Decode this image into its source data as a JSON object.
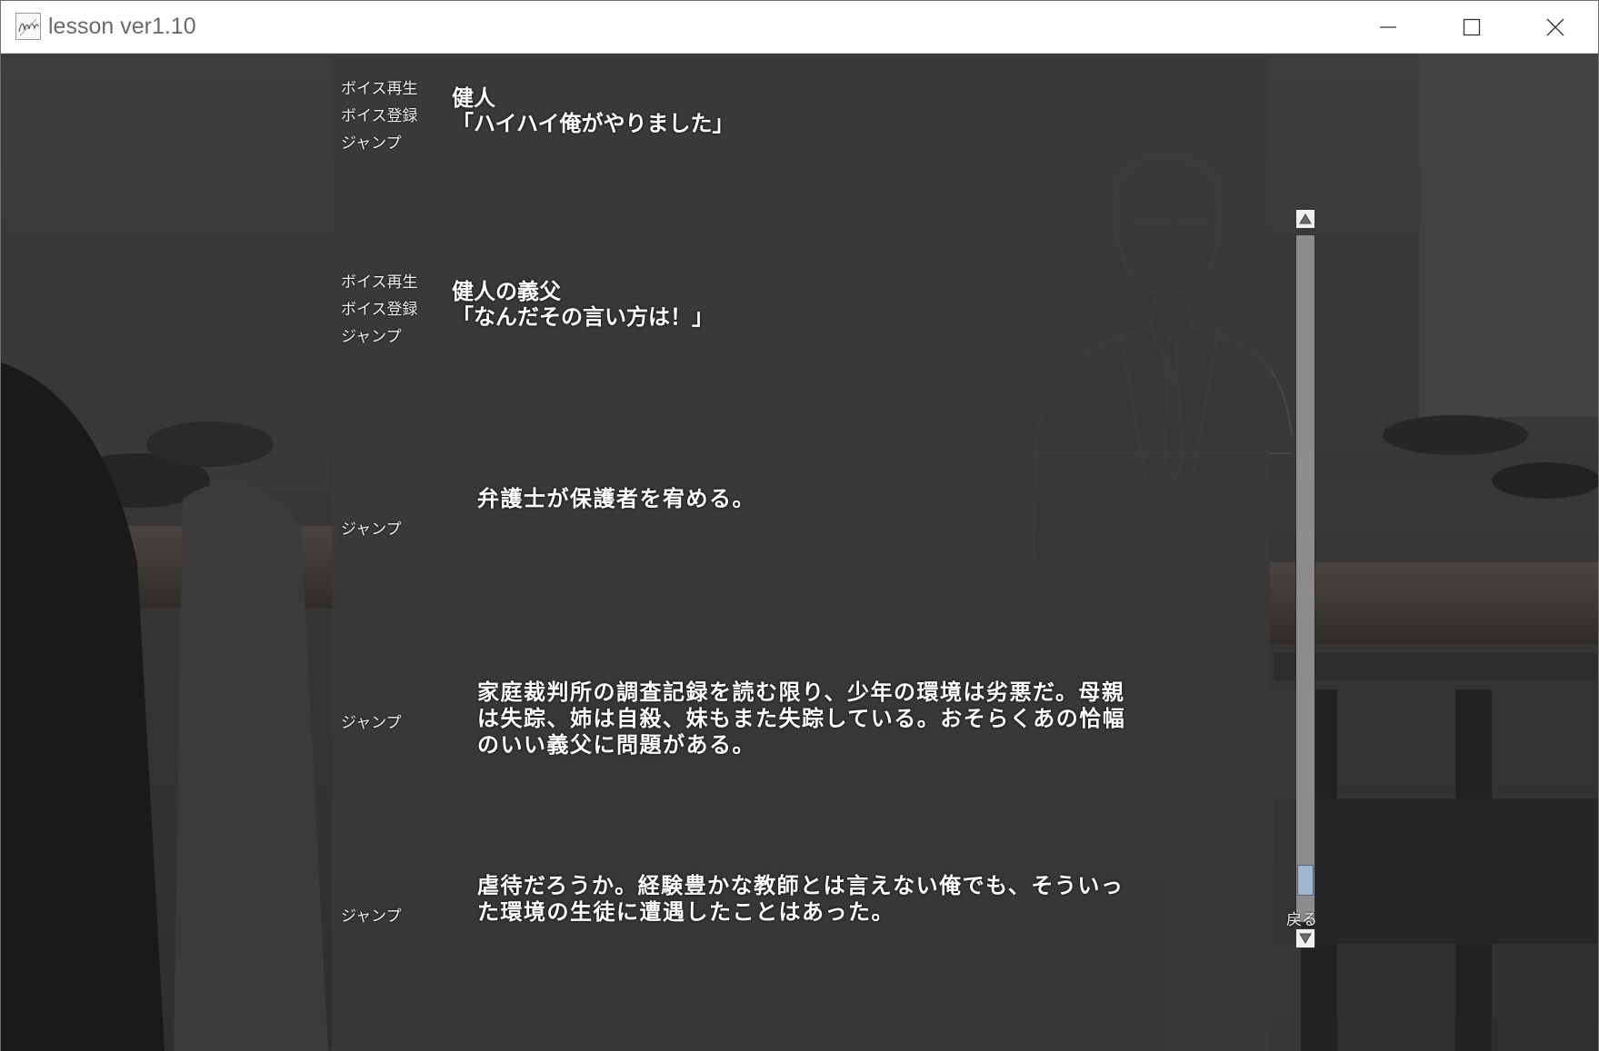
{
  "window": {
    "title": "lesson ver1.10"
  },
  "log": {
    "entries": [
      {
        "links": [
          "ボイス再生",
          "ボイス登録",
          "ジャンプ"
        ],
        "speaker": "健人",
        "text": "「ハイハイ俺がやりました」"
      },
      {
        "links": [
          "ボイス再生",
          "ボイス登録",
          "ジャンプ"
        ],
        "speaker": "健人の義父",
        "text": "「なんだその言い方は！」"
      },
      {
        "links": [
          "ジャンプ"
        ],
        "speaker": "",
        "text": "弁護士が保護者を宥める。"
      },
      {
        "links": [
          "ジャンプ"
        ],
        "speaker": "",
        "text": "家庭裁判所の調査記録を読む限り、少年の環境は劣悪だ。母親\nは失踪、姉は自殺、妹もまた失踪している。おそらくあの恰幅\nのいい義父に問題がある。"
      },
      {
        "links": [
          "ジャンプ"
        ],
        "speaker": "",
        "text": "虐待だろうか。経験豊かな教師とは言えない俺でも、そういっ\nた環境の生徒に遭遇したことはあった。"
      }
    ]
  },
  "scrollbar": {
    "position": 0.96
  },
  "back_label": "戻る"
}
